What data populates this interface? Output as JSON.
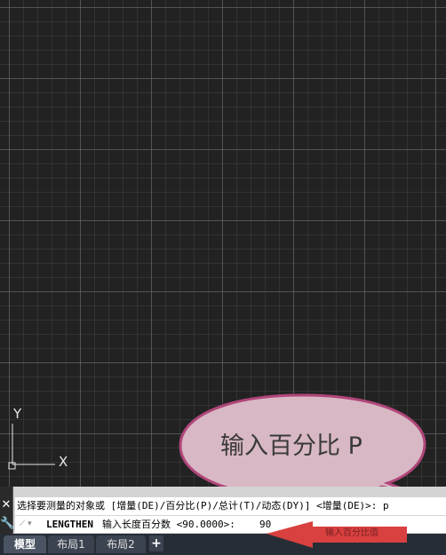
{
  "drawing_area": {
    "ucs_icon": {
      "x_label": "X",
      "y_label": "Y"
    }
  },
  "callout": {
    "text": "输入百分比 P",
    "fill_color": "#d8b8c4",
    "border_color": "#b0467a"
  },
  "command_panel": {
    "close_icon": "close-icon",
    "settings_icon": "wrench-icon",
    "history_line": "选择要测量的对象或 [增量(DE)/百分比(P)/总计(T)/动态(DY)] <增量(DE)>: p",
    "command_name": "LENGTHEN",
    "command_prompt": "输入长度百分数 <90.0000>:",
    "input_value": "90"
  },
  "annotation_arrow": {
    "text": "输入百分比值",
    "color": "#d94040"
  },
  "tabs": [
    {
      "label": "模型",
      "active": true
    },
    {
      "label": "布局1",
      "active": false
    },
    {
      "label": "布局2",
      "active": false
    }
  ],
  "add_tab_label": "+"
}
